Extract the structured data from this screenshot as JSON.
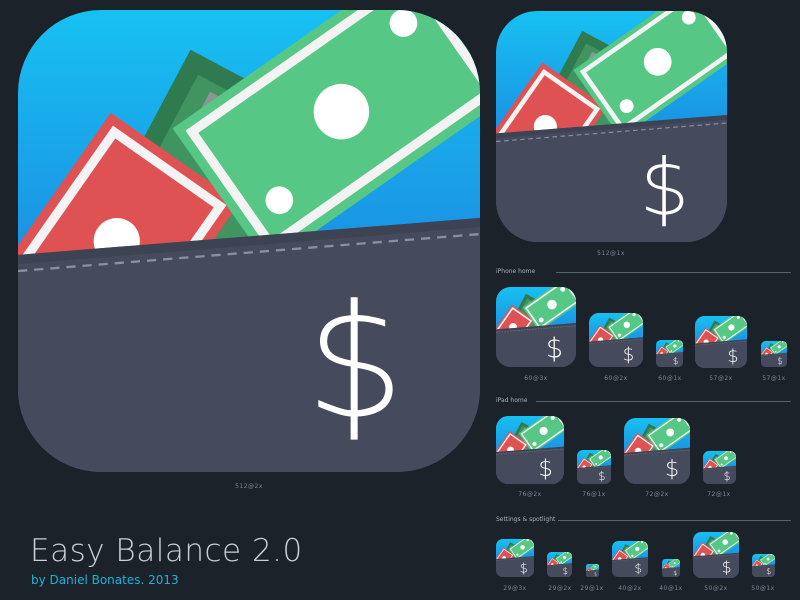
{
  "app": {
    "title": "Easy Balance 2.0",
    "credit": "by Daniel Bonates. 2013"
  },
  "colors": {
    "background": "#1b2229",
    "sky_top": "#17c1f2",
    "sky_bottom": "#1e66d6",
    "pocket": "#454a5c",
    "bill_green": "#57c785",
    "bill_red": "#df5253",
    "bill_dark_green": "#2f7a4e",
    "accent_text": "#1ab3dc"
  },
  "icon": {
    "name": "wallet-money-icon",
    "symbol": "$"
  },
  "main_icon": {
    "label": "512@2x"
  },
  "medium_icon": {
    "label": "512@1x"
  },
  "sections": [
    {
      "title": "iPhone home",
      "icons": [
        {
          "label": "60@3x"
        },
        {
          "label": "60@2x"
        },
        {
          "label": "60@1x"
        },
        {
          "label": "57@2x"
        },
        {
          "label": "57@1x"
        }
      ]
    },
    {
      "title": "iPad home",
      "icons": [
        {
          "label": "76@2x"
        },
        {
          "label": "76@1x"
        },
        {
          "label": "72@2x"
        },
        {
          "label": "72@1x"
        }
      ]
    },
    {
      "title": "Settings & spotlight",
      "icons": [
        {
          "label": "29@3x"
        },
        {
          "label": "29@2x"
        },
        {
          "label": "29@1x"
        },
        {
          "label": "40@2x"
        },
        {
          "label": "40@1x"
        },
        {
          "label": "50@2x"
        },
        {
          "label": "50@1x"
        }
      ]
    }
  ]
}
